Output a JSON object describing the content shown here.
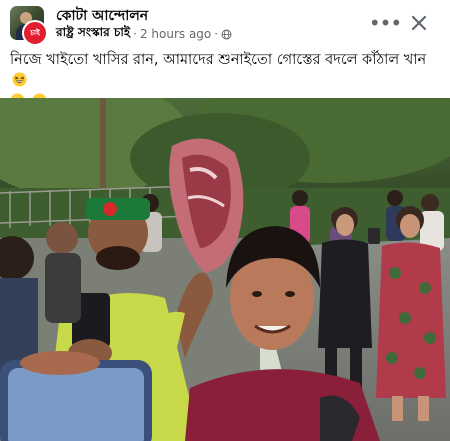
{
  "post": {
    "group_name": "কোটা আন্দোলন",
    "author": "রাষ্ট্র সংস্কার চাই",
    "separator": "·",
    "time": "2 hours ago",
    "separator2": "·",
    "avatar_badge": "চাই",
    "caption_line1": "নিজে খাইতো খাসির রান, আমাদের শুনাইতো গোস্তের বদলে কাঁঠাল খান",
    "emoji_name": "grinning-squinting-face-emoji",
    "emoji_count": 3
  },
  "actions": {
    "more_icon": "more-horizontal-icon",
    "close_icon": "close-icon"
  },
  "photo": {
    "description_icon": "post-photo"
  },
  "colors": {
    "secondary_text": "#65676b",
    "primary_text": "#050505",
    "badge_red": "#e11d2e"
  }
}
